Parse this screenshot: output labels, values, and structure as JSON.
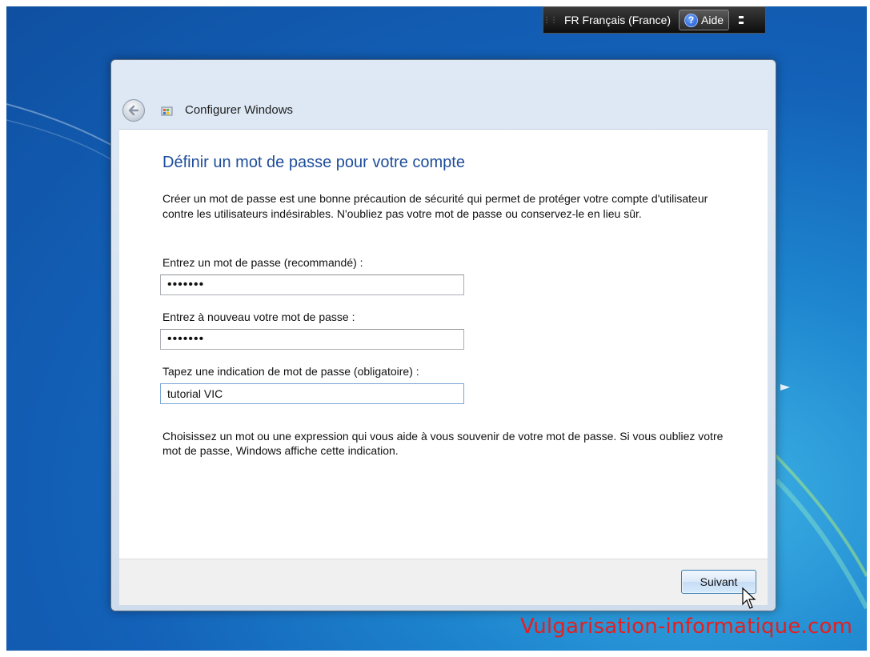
{
  "langbar": {
    "language_label": "FR Français (France)",
    "help_label": "Aide",
    "help_icon": "help-question-icon"
  },
  "window": {
    "title": "Configurer Windows",
    "heading": "Définir un mot de passe pour votre compte",
    "intro": "Créer un mot de passe est une bonne précaution de sécurité qui permet de protéger votre compte d'utilisateur contre les utilisateurs indésirables. N'oubliez pas votre mot de passe ou conservez-le en lieu sûr.",
    "password_label": "Entrez un mot de passe (recommandé) :",
    "password_value": "•••••••",
    "confirm_label": "Entrez à nouveau votre mot de passe :",
    "confirm_value": "•••••••",
    "hint_label": "Tapez une indication de mot de passe (obligatoire) :",
    "hint_value": "tutorial VIC",
    "hint_help": "Choisissez un mot ou une expression qui vous aide à vous souvenir de votre mot de passe. Si vous oubliez votre mot de passe, Windows affiche cette indication.",
    "next_label": "Suivant"
  },
  "watermark": "Vulgarisation-informatique.com",
  "colors": {
    "heading": "#1e4d9b",
    "watermark": "#e41f1f",
    "desktop": "#1361b8"
  }
}
